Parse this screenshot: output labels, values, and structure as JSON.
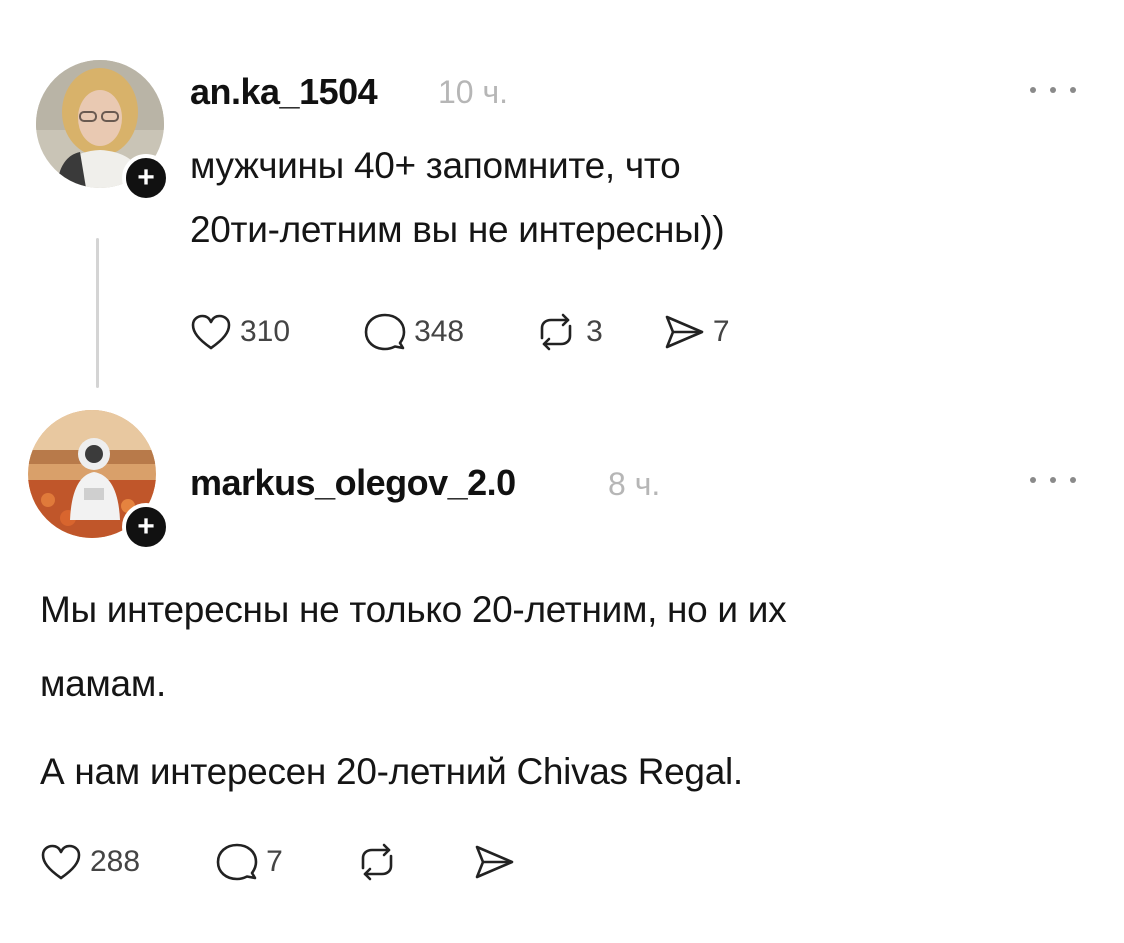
{
  "post": {
    "username": "an.ka_1504",
    "time": "10 ч.",
    "text_line1": "мужчины 40+ запомните, что",
    "text_line2": "20ти-летним вы не интересны))",
    "likes": "310",
    "comments": "348",
    "reposts": "3",
    "shares": "7"
  },
  "reply": {
    "username": "markus_olegov_2.0",
    "time": "8 ч.",
    "text_line1": "Мы интересны не только 20-летним, но и их",
    "text_line2": "мамам.",
    "text_line3": "А нам интересен 20-летний Chivas Regal.",
    "likes": "288",
    "comments": "7"
  },
  "icons": {
    "like": "heart-icon",
    "comment": "comment-bubble-icon",
    "repost": "repost-icon",
    "share": "send-icon",
    "more": "more-dots-icon",
    "follow": "plus-icon"
  },
  "colors": {
    "text": "#111111",
    "muted": "#b6b6b6",
    "thread_line": "#d4d4d4"
  }
}
